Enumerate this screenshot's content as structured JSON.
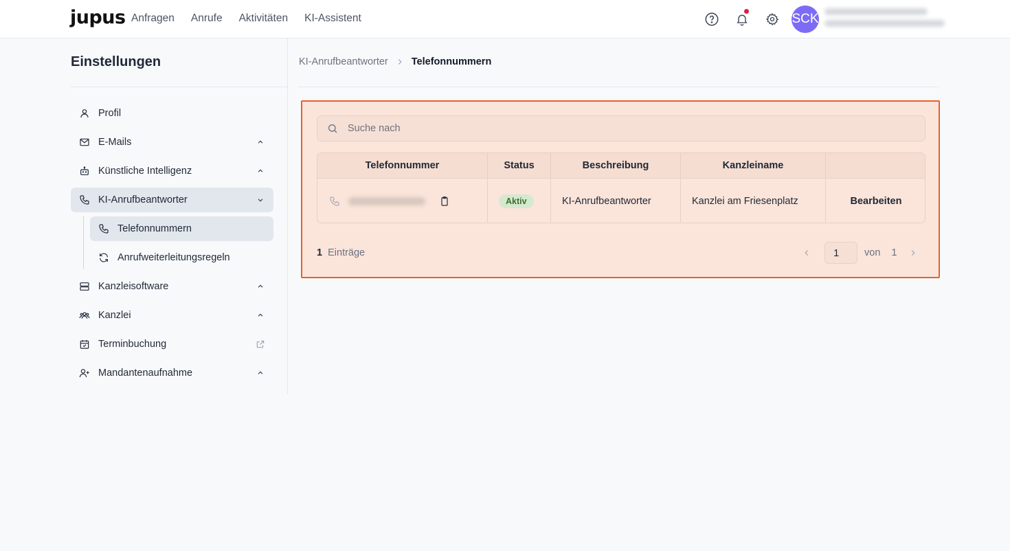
{
  "brand": "jupus",
  "topnav": [
    "Anfragen",
    "Anrufe",
    "Aktivitäten",
    "KI-Assistent"
  ],
  "user": {
    "initials": "SCK"
  },
  "icons": {
    "help": "help-circle-icon",
    "bell": "bell-icon",
    "settings": "gear-icon"
  },
  "colors": {
    "accent": "#7c6cf5",
    "highlight_border": "#e5622a",
    "badge_bg": "#d5e9cf",
    "notification_dot": "#e11d48"
  },
  "sidebar": {
    "title": "Einstellungen",
    "items": [
      {
        "label": "Profil"
      },
      {
        "label": "E-Mails"
      },
      {
        "label": "Künstliche Intelligenz"
      },
      {
        "label": "KI-Anrufbeantworter"
      },
      {
        "label": "Telefonnummern"
      },
      {
        "label": "Anrufweiterleitungsregeln"
      },
      {
        "label": "Kanzleisoftware"
      },
      {
        "label": "Kanzlei"
      },
      {
        "label": "Terminbuchung"
      },
      {
        "label": "Mandantenaufnahme"
      }
    ]
  },
  "breadcrumb": {
    "parent": "KI-Anrufbeantworter",
    "current": "Telefonnummern"
  },
  "search": {
    "placeholder": "Suche nach"
  },
  "table": {
    "headers": [
      "Telefonnummer",
      "Status",
      "Beschreibung",
      "Kanzleiname",
      ""
    ],
    "rows": [
      {
        "status": "Aktiv",
        "description": "KI-Anrufbeantworter",
        "office": "Kanzlei am Friesenplatz",
        "action": "Bearbeiten"
      }
    ]
  },
  "footer": {
    "count": "1",
    "count_label": "Einträge",
    "page": "1",
    "of_label": "von",
    "total_pages": "1"
  }
}
